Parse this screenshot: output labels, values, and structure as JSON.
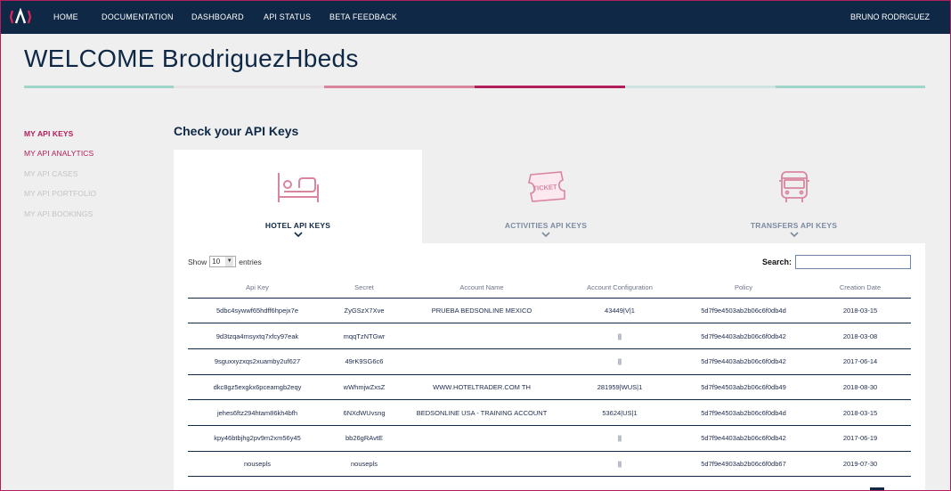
{
  "nav": {
    "items": [
      "HOME",
      "DOCUMENTATION",
      "DASHBOARD",
      "API STATUS",
      "BETA FEEDBACK"
    ],
    "user": "BRUNO RODRIGUEZ",
    "logo_icon": "brand-logo-icon"
  },
  "welcome": "WELCOME BrodriguezHbeds",
  "sidebar": {
    "items": [
      {
        "label": "MY API KEYS",
        "state": "active"
      },
      {
        "label": "MY API ANALYTICS",
        "state": "enabled"
      },
      {
        "label": "MY API CASES",
        "state": "disabled"
      },
      {
        "label": "MY API PORTFOLIO",
        "state": "disabled"
      },
      {
        "label": "MY API BOOKINGS",
        "state": "disabled"
      }
    ]
  },
  "section_title": "Check your API Keys",
  "tabs": [
    {
      "label": "HOTEL API KEYS",
      "icon": "bed-icon",
      "active": true
    },
    {
      "label": "ACTIVITIES API KEYS",
      "icon": "ticket-icon",
      "active": false
    },
    {
      "label": "TRANSFERS API KEYS",
      "icon": "bus-icon",
      "active": false
    }
  ],
  "ticket_text": "TICKET",
  "table_controls": {
    "show_label": "Show",
    "page_length": "10",
    "entries_label": "entries",
    "search_label": "Search:",
    "search_value": ""
  },
  "table": {
    "columns": [
      "Api Key",
      "Secret",
      "Account Name",
      "Account Configuration",
      "Policy",
      "Creation Date"
    ],
    "rows": [
      [
        "5dbc4sywwf65hdff6hpejx7e",
        "ZyGSzX7Xve",
        "PRUEBA BEDSONLINE MEXICO",
        "43449|V|1",
        "5d7f9e4503ab2b06c6f0db4d",
        "2018-03-15"
      ],
      [
        "9d3tzqa4msyxtq7xfcy97eak",
        "mqqTzNTGwr",
        "",
        "||",
        "5d7f9e4403ab2b06c6f0db42",
        "2018-03-08"
      ],
      [
        "9sguxxyzxqs2xuamby2uf627",
        "49rK9SG6c6",
        "",
        "||",
        "5d7f9e4403ab2b06c6f0db42",
        "2017-06-14"
      ],
      [
        "dkc8gz5exgkx6pceamgb2eqy",
        "wWhmjwZxsZ",
        "WWW.HOTELTRADER.COM TH",
        "281959|WUS|1",
        "5d7f9e4503ab2b06c6f0db49",
        "2018-08-30"
      ],
      [
        "jehes6ftz294htam86kh4bfh",
        "6NXdWUvsng",
        "BEDSONLINE USA - TRAINING ACCOUNT",
        "53624|US|1",
        "5d7f9e4503ab2b06c6f0db4d",
        "2018-03-15"
      ],
      [
        "kpy46btbjhg2pv9m2xm56y45",
        "bb26gRAvtE",
        "",
        "||",
        "5d7f9e4403ab2b06c6f0db42",
        "2017-06-19"
      ],
      [
        "nousepls",
        "nousepls",
        "",
        "||",
        "5d7f9e4903ab2b06c6f0db67",
        "2019-07-30"
      ]
    ]
  },
  "colors": {
    "navy": "#0e2845",
    "crimson": "#b21e5b",
    "pink": "#d9859e",
    "teal": "#9fd4cb",
    "muted_text": "#7c8aa0",
    "disabled_text": "#c4c4c4"
  }
}
